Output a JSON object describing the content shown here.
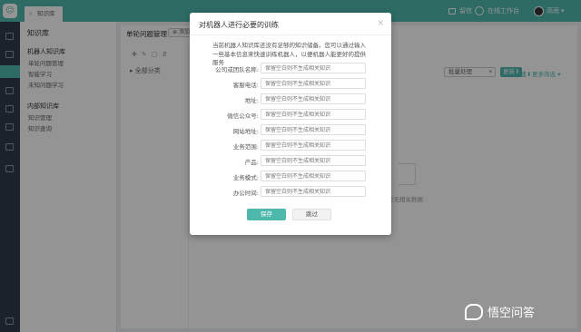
{
  "topbar": {
    "tab_label": "知识库",
    "messages_label": "留信",
    "online_label": "在线工作台",
    "user_name": "高雨"
  },
  "sidebar": {
    "section_title": "知识库",
    "groups": [
      {
        "label": "机器人知识库",
        "items": [
          "单轮问题管理",
          "智能学习",
          "未知问题学习"
        ]
      },
      {
        "label": "内部知识库",
        "items": [
          "知识管理",
          "知识查询"
        ]
      }
    ]
  },
  "main": {
    "title": "单轮问题管理",
    "add_label": "添加",
    "tree_root": "全部分类",
    "bulk_label": "批量处理",
    "sort_label": "更新",
    "sort2_label": "创建",
    "filter_label": "更多筛选",
    "empty_text": "暂无相关数据"
  },
  "modal": {
    "title": "对机器人进行必要的训练",
    "description": "当前机器人知识库还没有足够的知识储备。您可以通过输入一些基本信息来快速训练机器人，以便机器人能更好的提供服务",
    "placeholder": "保留空白则不生成相关知识",
    "fields": [
      {
        "label": "公司或团队名称:"
      },
      {
        "label": "客服电话:"
      },
      {
        "label": "地址:"
      },
      {
        "label": "微信公众号:"
      },
      {
        "label": "网站地址:"
      },
      {
        "label": "业务范围:"
      },
      {
        "label": "产品:"
      },
      {
        "label": "业务模式:"
      },
      {
        "label": "办公时间:"
      }
    ],
    "save_label": "保存",
    "skip_label": "跳过"
  },
  "watermark": {
    "text": "悟空问答"
  }
}
